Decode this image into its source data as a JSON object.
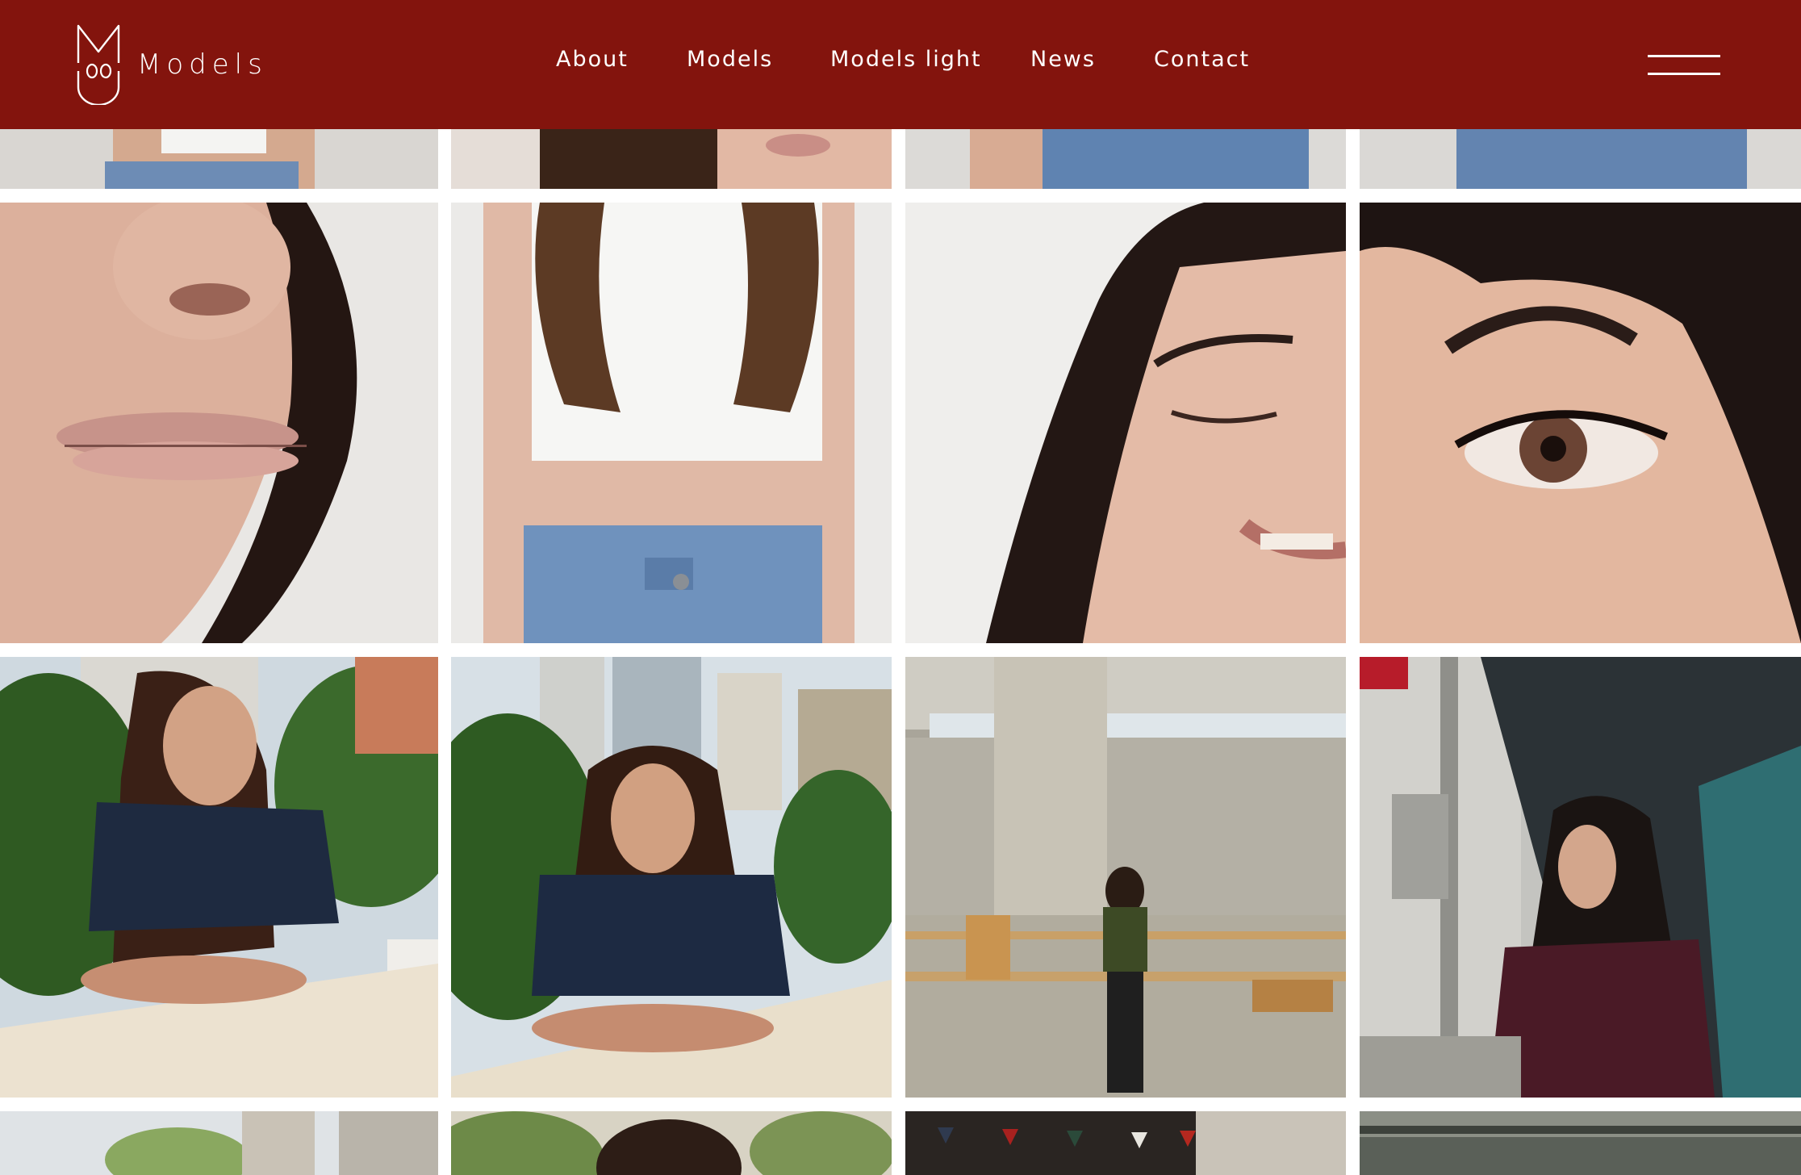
{
  "brand": {
    "name": "Models",
    "header_color": "#83140d",
    "text_color": "#ffffff"
  },
  "nav": {
    "items": [
      {
        "label": "About"
      },
      {
        "label": "Models"
      },
      {
        "label": "Models light"
      },
      {
        "label": "News"
      },
      {
        "label": "Contact"
      }
    ]
  },
  "menu": {
    "icon": "hamburger-icon"
  },
  "gallery": {
    "photos": [
      {
        "subject": "cropped torso with white top and jeans"
      },
      {
        "subject": "cropped chin and long hair"
      },
      {
        "subject": "cropped jeans waistband"
      },
      {
        "subject": "cropped jeans pocket"
      },
      {
        "subject": "close-up of nose and lips"
      },
      {
        "subject": "torso in white crop top and jeans"
      },
      {
        "subject": "smiling face with closed eyes"
      },
      {
        "subject": "close-up of eye and dark hair"
      },
      {
        "subject": "woman leaning on railing outdoors among trees"
      },
      {
        "subject": "woman leaning forward on railing with city buildings"
      },
      {
        "subject": "woman standing in a stone-columned lobby"
      },
      {
        "subject": "woman in profile beside a teal building"
      },
      {
        "subject": "outdoor terrace with plants"
      },
      {
        "subject": "top of head among plants"
      },
      {
        "subject": "market with bunting flags"
      },
      {
        "subject": "building facade with windows"
      }
    ]
  }
}
